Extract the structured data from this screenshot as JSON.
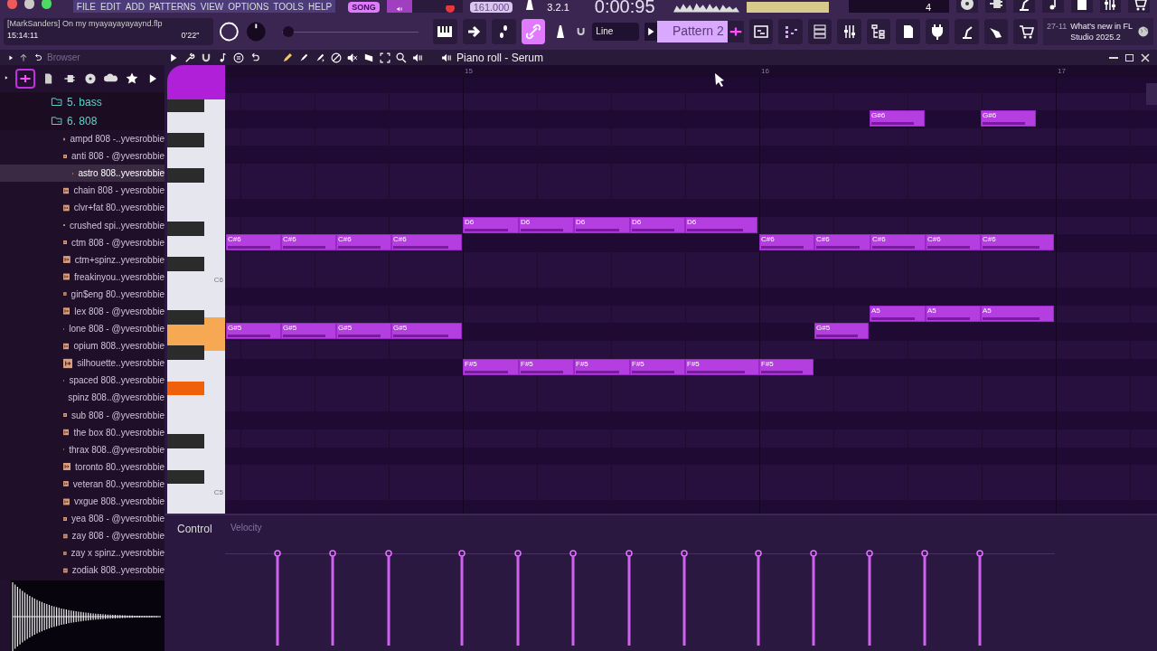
{
  "menu": [
    "FILE",
    "EDIT",
    "ADD",
    "PATTERNS",
    "VIEW",
    "OPTIONS",
    "TOOLS",
    "HELP"
  ],
  "transport": {
    "mode": "SONG",
    "tempo": "161.000",
    "time": "0:00:95",
    "step": "3.2.1",
    "count": "4"
  },
  "project": {
    "title": "[MarkSanders] On my myayayayayaynd.flp",
    "clock": "15:14:11",
    "length": "0'22\""
  },
  "pitch": {
    "level": 0.0
  },
  "snap": "Line",
  "pattern": "Pattern 2",
  "news": {
    "date": "27-11",
    "text": "What's new in FL Studio 2025.2"
  },
  "browser": {
    "title": "Browser",
    "folders": [
      {
        "label": "5. bass"
      },
      {
        "label": "6. 808"
      }
    ],
    "files": [
      {
        "label": "ampd 808 -..yvesrobbie",
        "selected": false
      },
      {
        "label": "anti 808 - @yvesrobbie",
        "selected": false
      },
      {
        "label": "astro 808..yvesrobbie",
        "selected": true
      },
      {
        "label": "chain 808 - yvesrobbie",
        "selected": false
      },
      {
        "label": "clvr+fat 80..yvesrobbie",
        "selected": false
      },
      {
        "label": "crushed spi..yvesrobbie",
        "selected": false
      },
      {
        "label": "ctm 808 - @yvesrobbie",
        "selected": false
      },
      {
        "label": "ctm+spinz..yvesrobbie",
        "selected": false
      },
      {
        "label": "freakinyou..yvesrobbie",
        "selected": false
      },
      {
        "label": "gin$eng 80..yvesrobbie",
        "selected": false
      },
      {
        "label": "lex 808 - @yvesrobbie",
        "selected": false
      },
      {
        "label": "lone 808 - @yvesrobbie",
        "selected": false
      },
      {
        "label": "opium 808..yvesrobbie",
        "selected": false
      },
      {
        "label": "silhouette..yvesrobbie",
        "selected": false
      },
      {
        "label": "spaced 808..yvesrobbie",
        "selected": false
      },
      {
        "label": "spinz 808..@yvesrobbie",
        "selected": false
      },
      {
        "label": "sub 808 - @yvesrobbie",
        "selected": false
      },
      {
        "label": "the box 80..yvesrobbie",
        "selected": false
      },
      {
        "label": "thrax 808..@yvesrobbie",
        "selected": false
      },
      {
        "label": "toronto 80..yvesrobbie",
        "selected": false
      },
      {
        "label": "veteran 80..yvesrobbie",
        "selected": false
      },
      {
        "label": "vxgue 808..yvesrobbie",
        "selected": false
      },
      {
        "label": "yea 808 - @yvesrobbie",
        "selected": false
      },
      {
        "label": "zay 808 - @yvesrobbie",
        "selected": false
      },
      {
        "label": "zay x spinz..yvesrobbie",
        "selected": false
      },
      {
        "label": "zodiak 808..yvesrobbie",
        "selected": false
      }
    ]
  },
  "piano_roll": {
    "title": "Piano roll - Serum",
    "bars": [
      "15",
      "16",
      "17"
    ],
    "key_labels": [
      "C6",
      "C5"
    ],
    "note_rows": [
      {
        "notes": [
          "G#6",
          "G#6"
        ]
      },
      {
        "notes": [
          "D6",
          "D6",
          "D6",
          "D6",
          "D6"
        ]
      },
      {
        "notes": [
          "C#6",
          "C#6",
          "C#6",
          "C#6",
          "C#6",
          "C#6",
          "C#6",
          "C#6",
          "C#6"
        ]
      },
      {
        "notes": [
          "A5",
          "A5",
          "A5"
        ]
      },
      {
        "notes": [
          "G#5",
          "G#5",
          "G#5",
          "G#5",
          "G#5"
        ]
      },
      {
        "notes": [
          "F#5",
          "F#5",
          "F#5",
          "F#5",
          "F#5",
          "F#5"
        ]
      }
    ],
    "control": {
      "label": "Control",
      "target": "Velocity"
    }
  }
}
